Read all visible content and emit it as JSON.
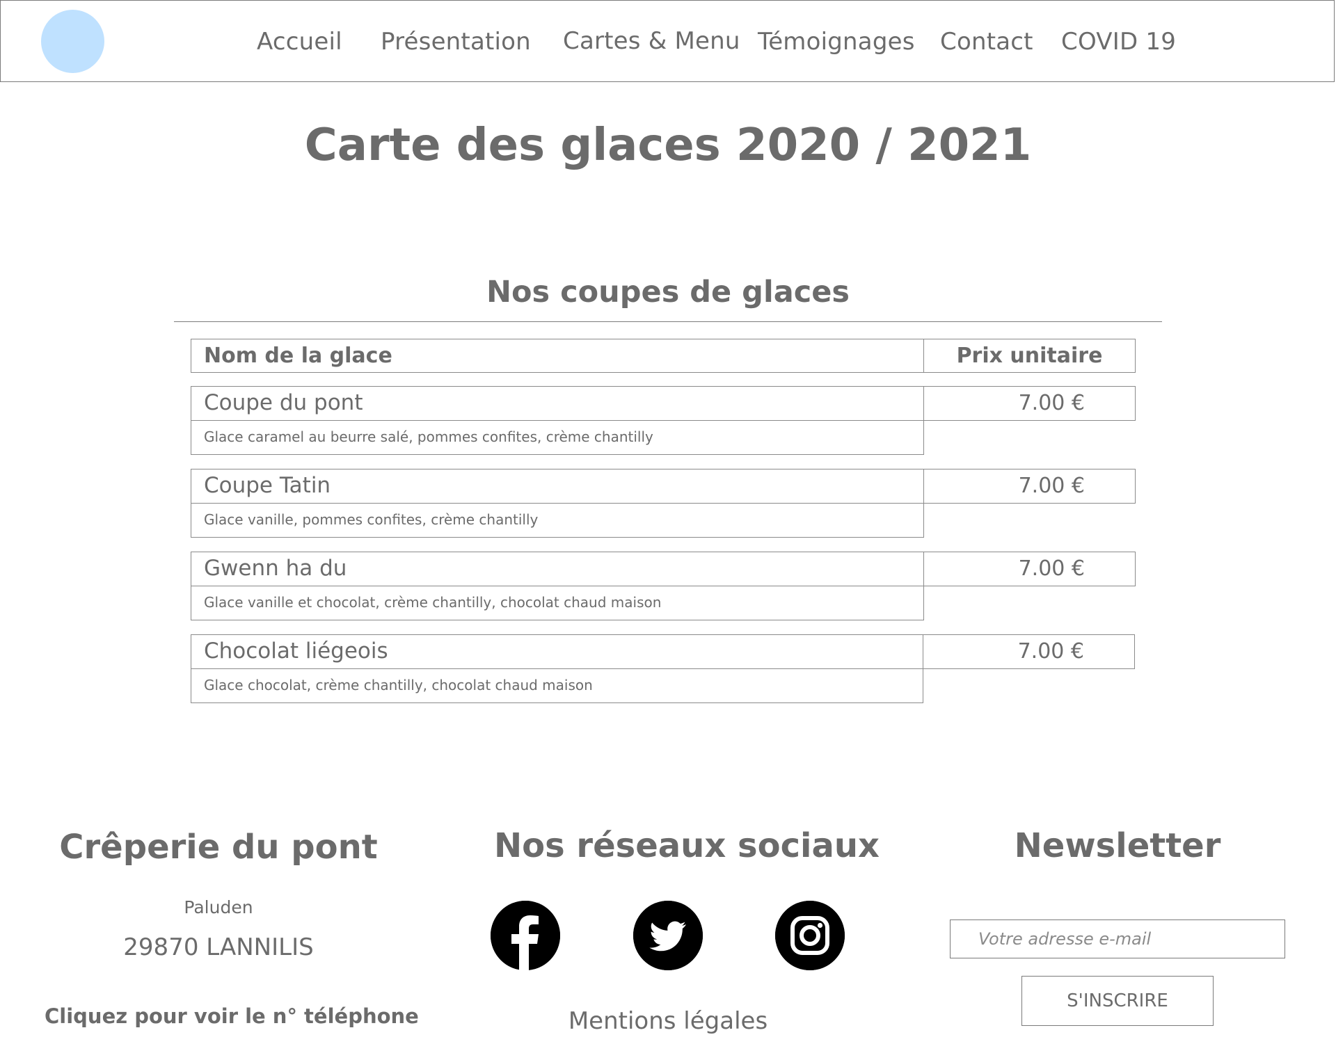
{
  "header": {
    "nav": [
      "Accueil",
      "Présentation",
      "Cartes & Menu",
      "Témoignages",
      "Contact",
      "COVID 19"
    ]
  },
  "page_title": "Carte des glaces 2020 / 2021",
  "section_title": "Nos coupes de glaces",
  "table": {
    "col_name": "Nom de la glace",
    "col_price": "Prix unitaire",
    "items": [
      {
        "name": "Coupe du pont",
        "price": "7.00 €",
        "desc": "Glace caramel au beurre salé, pommes confites, crème chantilly"
      },
      {
        "name": "Coupe Tatin",
        "price": "7.00 €",
        "desc": "Glace vanille, pommes confites, crème chantilly"
      },
      {
        "name": "Gwenn ha du",
        "price": "7.00 €",
        "desc": "Glace vanille et chocolat, crème chantilly, chocolat chaud maison"
      },
      {
        "name": "Chocolat liégeois",
        "price": "7.00 €",
        "desc": "Glace chocolat, crème chantilly, chocolat chaud maison"
      }
    ]
  },
  "footer": {
    "address": {
      "title": "Crêperie du pont",
      "line1": "Paluden",
      "line2": "29870 LANNILIS",
      "phone_link": "Cliquez pour voir le n° téléphone"
    },
    "social": {
      "title": "Nos réseaux sociaux",
      "icons": [
        "facebook-icon",
        "twitter-icon",
        "instagram-icon"
      ],
      "legal": "Mentions légales"
    },
    "newsletter": {
      "title": "Newsletter",
      "placeholder": "Votre adresse e-mail",
      "button": "S'INSCRIRE"
    }
  },
  "colors": {
    "text": "#6b6b6b",
    "logo": "#bfe1ff",
    "border": "#8a8a8a",
    "social_bg": "#000000"
  }
}
